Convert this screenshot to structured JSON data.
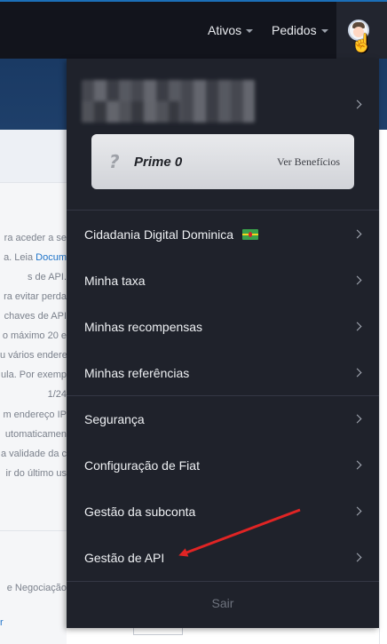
{
  "topbar": {
    "nav": [
      {
        "label": "Ativos"
      },
      {
        "label": "Pedidos"
      }
    ]
  },
  "background": {
    "lines": [
      "ra aceder a se",
      "a. Leia ",
      "Docum",
      "s de API.",
      "ra evitar perda",
      "chaves de API",
      "o máximo 20 e",
      "u vários endere",
      "ula. Por exemp",
      "1/24",
      "m endereço IP",
      "utomaticamen",
      "a validade da c",
      "ir do último us",
      "e Negociação",
      "r"
    ]
  },
  "menu": {
    "prime": {
      "label": "Prime 0",
      "link": "Ver Benefícios"
    },
    "items": [
      {
        "label": "Cidadania Digital Dominica"
      },
      {
        "label": "Minha taxa"
      },
      {
        "label": "Minhas recompensas"
      },
      {
        "label": "Minhas referências"
      },
      {
        "label": "Segurança"
      },
      {
        "label": "Configuração de Fiat"
      },
      {
        "label": "Gestão da subconta"
      },
      {
        "label": "Gestão de API"
      }
    ],
    "logout": "Sair"
  },
  "colors": {
    "nav_bg": "#12141c",
    "menu_bg": "#1f222b",
    "annotation_arrow": "#e02424",
    "link": "#1f74c9"
  },
  "icons": [
    "caret-down-icon",
    "avatar-icon",
    "hand-cursor-icon",
    "chevron-right-icon",
    "prime-badge-icon",
    "dominica-flag-icon"
  ]
}
